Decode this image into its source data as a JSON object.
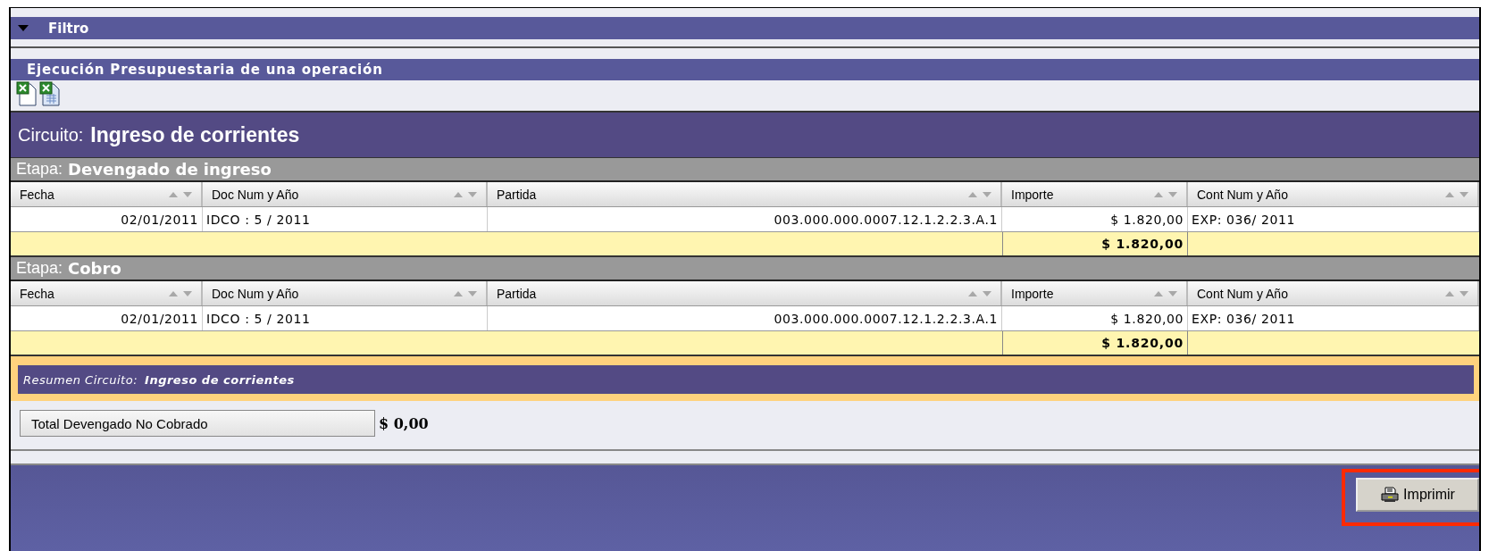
{
  "filter_bar": {
    "title": "Filtro",
    "expanded": true
  },
  "report": {
    "title": "Ejecución Presupuestaria de una operación"
  },
  "circuit": {
    "label": "Circuito:",
    "name": "Ingreso de corrientes"
  },
  "stages": [
    {
      "label": "Etapa:",
      "name": "Devengado de ingreso",
      "columns": [
        "Fecha",
        "Doc Num y Año",
        "Partida",
        "Importe",
        "Cont Num y Año"
      ],
      "rows": [
        {
          "fecha": "02/01/2011",
          "doc": "IDCO : 5 / 2011",
          "partida": "003.000.000.0007.12.1.2.2.3.A.1",
          "importe": "$ 1.820,00",
          "cont": "EXP: 036/ 2011"
        }
      ],
      "total": "$ 1.820,00"
    },
    {
      "label": "Etapa:",
      "name": "Cobro",
      "columns": [
        "Fecha",
        "Doc Num y Año",
        "Partida",
        "Importe",
        "Cont Num y Año"
      ],
      "rows": [
        {
          "fecha": "02/01/2011",
          "doc": "IDCO : 5 / 2011",
          "partida": "003.000.000.0007.12.1.2.2.3.A.1",
          "importe": "$ 1.820,00",
          "cont": "EXP: 036/ 2011"
        }
      ],
      "total": "$ 1.820,00"
    }
  ],
  "summary": {
    "label": "Resumen Circuito:",
    "name": "Ingreso de corrientes"
  },
  "totals": [
    {
      "label": "Total Devengado No Cobrado",
      "value": "$ 0,00"
    }
  ],
  "print_button": {
    "label": "Imprimir",
    "highlighted": true
  }
}
